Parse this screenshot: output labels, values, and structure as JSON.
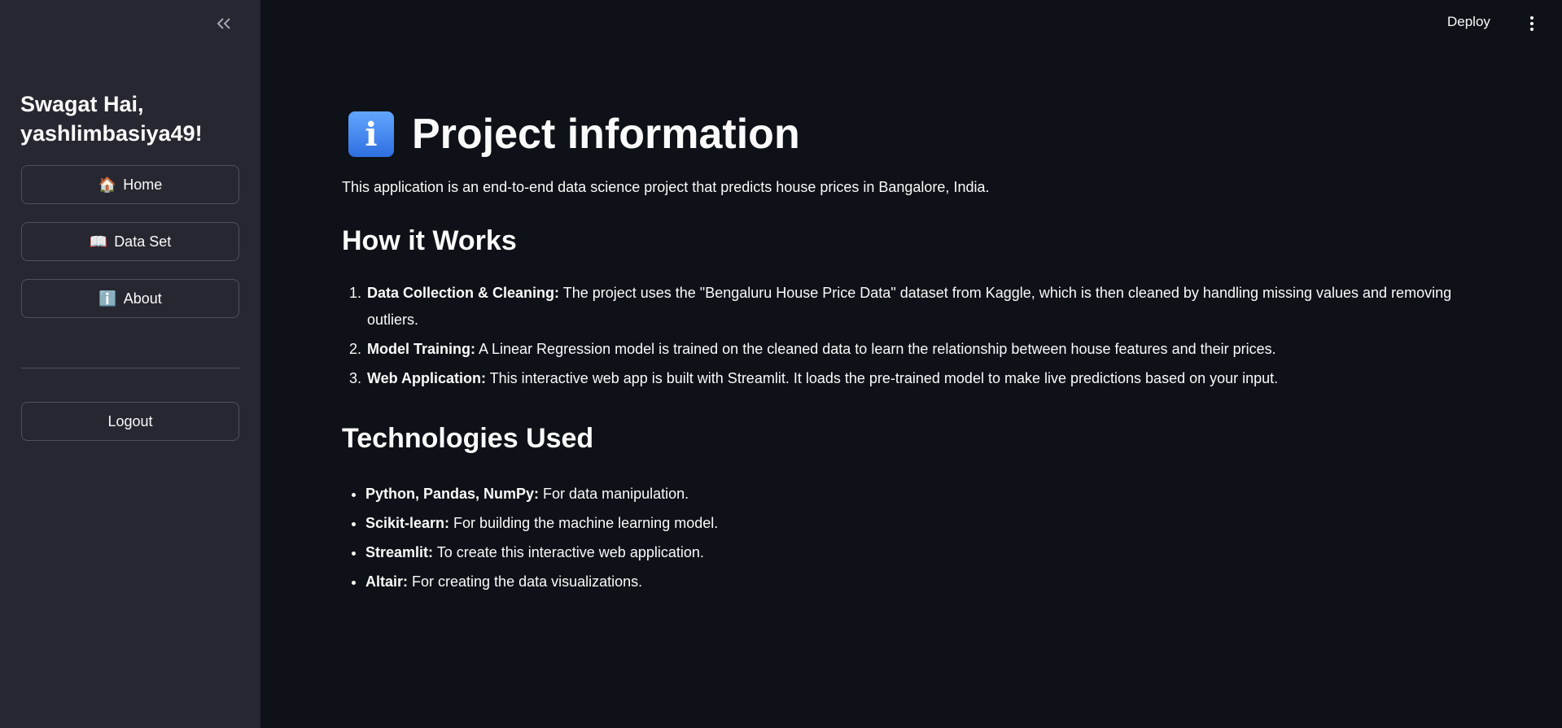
{
  "sidebar": {
    "collapse_icon": "«",
    "greeting": "Swagat Hai, yashlimbasiya49!",
    "nav": [
      {
        "emoji": "🏠",
        "label": "Home"
      },
      {
        "emoji": "📖",
        "label": "Data Set"
      },
      {
        "emoji": "ℹ️",
        "label": "About"
      }
    ],
    "logout_label": "Logout"
  },
  "topbar": {
    "deploy_label": "Deploy",
    "menu_icon": "more-vertical-icon"
  },
  "main": {
    "title_icon": "i",
    "title": "Project information",
    "intro": "This application is an end-to-end data science project that predicts house prices in Bangalore, India.",
    "how_title": "How it Works",
    "steps": [
      {
        "bold": "Data Collection & Cleaning:",
        "text": " The project uses the \"Bengaluru House Price Data\" dataset from Kaggle, which is then cleaned by handling missing values and removing outliers."
      },
      {
        "bold": "Model Training:",
        "text": " A Linear Regression model is trained on the cleaned data to learn the relationship between house features and their prices."
      },
      {
        "bold": "Web Application:",
        "text": " This interactive web app is built with Streamlit. It loads the pre-trained model to make live predictions based on your input."
      }
    ],
    "tech_title": "Technologies Used",
    "tech": [
      {
        "bold": "Python, Pandas, NumPy:",
        "text": " For data manipulation."
      },
      {
        "bold": "Scikit-learn:",
        "text": " For building the machine learning model."
      },
      {
        "bold": "Streamlit:",
        "text": " To create this interactive web application."
      },
      {
        "bold": "Altair:",
        "text": " For creating the data visualizations."
      }
    ]
  },
  "colors": {
    "background": "#0e1117",
    "sidebar": "#262730",
    "text": "#fafafa"
  }
}
